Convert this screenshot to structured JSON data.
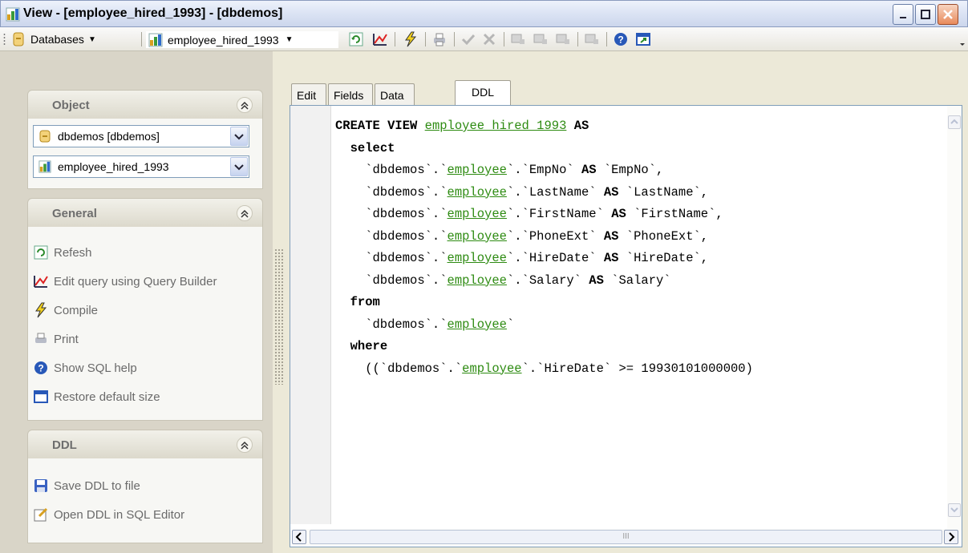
{
  "window": {
    "title": "View - [employee_hired_1993] - [dbdemos]"
  },
  "toolbar": {
    "databases_label": "Databases",
    "object_combo_value": "employee_hired_1993",
    "icons": [
      "refresh-icon",
      "query-builder-icon",
      "compile-icon",
      "print-icon",
      "commit-icon",
      "rollback-icon",
      "field-add-icon",
      "field-edit-icon",
      "field-delete-icon",
      "field-icon",
      "help-icon",
      "restore-size-icon"
    ]
  },
  "object_panel": {
    "title": "Object",
    "database_value": "dbdemos [dbdemos]",
    "object_value": "employee_hired_1993"
  },
  "general_panel": {
    "title": "General",
    "items": [
      {
        "label": "Refesh",
        "icon": "refresh-icon"
      },
      {
        "label": "Edit query using Query Builder",
        "icon": "query-builder-icon"
      },
      {
        "label": "Compile",
        "icon": "compile-icon"
      },
      {
        "label": "Print",
        "icon": "print-icon"
      },
      {
        "label": "Show SQL help",
        "icon": "help-icon"
      },
      {
        "label": "Restore default size",
        "icon": "restore-size-icon"
      }
    ]
  },
  "ddl_panel": {
    "title": "DDL",
    "items": [
      {
        "label": "Save DDL to file",
        "icon": "save-icon"
      },
      {
        "label": "Open DDL in SQL Editor",
        "icon": "open-editor-icon"
      }
    ]
  },
  "tabs": [
    {
      "label": "Edit",
      "active": false
    },
    {
      "label": "Fields",
      "active": false
    },
    {
      "label": "Data",
      "active": false
    },
    {
      "label": "DDL",
      "active": true
    }
  ],
  "ddl": {
    "view_name": "employee hired 1993",
    "table": "employee",
    "db": "dbdemos",
    "columns": [
      "EmpNo",
      "LastName",
      "FirstName",
      "PhoneExt",
      "HireDate",
      "Salary"
    ],
    "where_value": "19930101000000"
  },
  "colors": {
    "identifier": "#2e8b12",
    "window_bg": "#ece9d8"
  },
  "hscroll_thumb_label": "III"
}
